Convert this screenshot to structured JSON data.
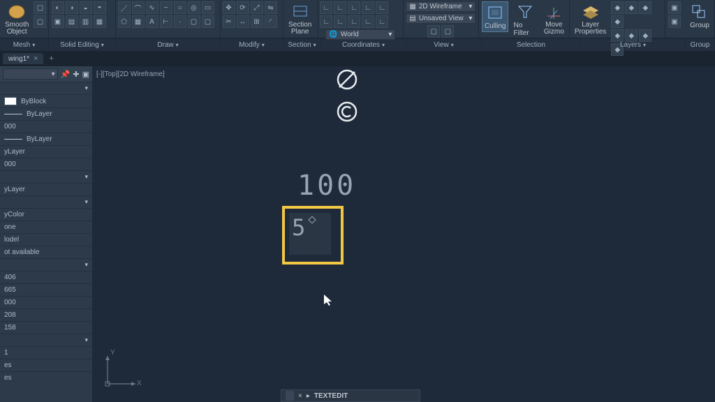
{
  "ribbon": {
    "mesh": {
      "smooth_object": "Smooth\nObject",
      "panel": "Mesh"
    },
    "solid_editing": "Solid Editing",
    "draw": "Draw",
    "modify": "Modify",
    "section": {
      "section_plane": "Section\nPlane",
      "panel": "Section"
    },
    "coordinates": {
      "world": "World",
      "panel": "Coordinates"
    },
    "view": {
      "wireframe": "2D Wireframe",
      "unsaved": "Unsaved View",
      "panel": "View"
    },
    "selection": {
      "culling": "Culling",
      "nofilter": "No Filter",
      "gizmo": "Move\nGizmo",
      "panel": "Selection"
    },
    "layers": {
      "layer_properties": "Layer\nProperties",
      "panel": "Layers"
    },
    "groups": {
      "group": "Group",
      "panel": "Group"
    }
  },
  "tabs": {
    "drawing1": "wing1*"
  },
  "canvas": {
    "view_label": "[-][Top][2D Wireframe]",
    "text_100": "100",
    "edit_text": "5",
    "ucs_x": "X",
    "ucs_y": "Y"
  },
  "cmd": {
    "text": "TEXTEDIT"
  },
  "props": {
    "byblock": "ByBlock",
    "bylayer1": "ByLayer",
    "thick": "000",
    "bylayer2": "ByLayer",
    "bylayer3": "yLayer",
    "zero1": "000",
    "bylayer4": "yLayer",
    "bycolor": "yColor",
    "none": "one",
    "model": "lodel",
    "not_available": "ot available",
    "v1": "406",
    "v2": "665",
    "v3": "000",
    "v4": "208",
    "v5": "158",
    "one": "1",
    "es1": "es",
    "es2": "es"
  }
}
